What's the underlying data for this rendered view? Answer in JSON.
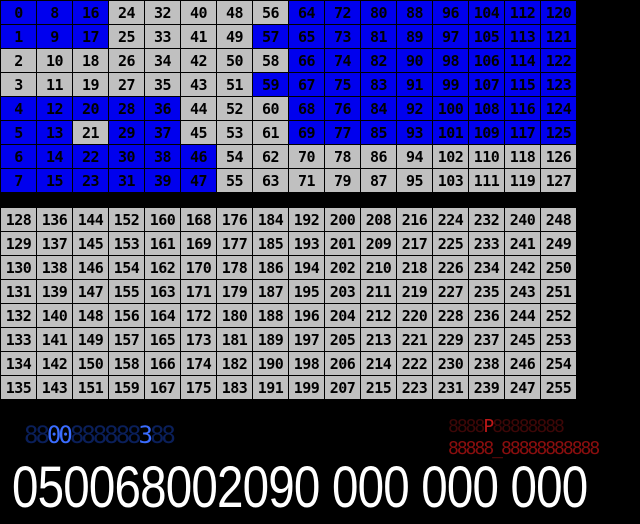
{
  "colors": {
    "active": "#0000ee",
    "inactive": "#c0c0c0",
    "background": "#000000",
    "lcd_blue": "#3a6cff",
    "lcd_red": "#c01818"
  },
  "top_grid": {
    "start": 0,
    "active": [
      0,
      1,
      4,
      5,
      6,
      7,
      8,
      9,
      12,
      13,
      14,
      15,
      16,
      17,
      20,
      22,
      23,
      28,
      29,
      30,
      31,
      36,
      37,
      38,
      39,
      46,
      47,
      57,
      59,
      64,
      65,
      66,
      67,
      68,
      69,
      72,
      73,
      74,
      75,
      76,
      77,
      80,
      81,
      82,
      83,
      84,
      85,
      88,
      89,
      90,
      91,
      92,
      93,
      96,
      97,
      98,
      99,
      100,
      101,
      104,
      105,
      106,
      107,
      108,
      109,
      112,
      113,
      114,
      115,
      116,
      117,
      120,
      121,
      122,
      123,
      124,
      125
    ]
  },
  "bottom_grid": {
    "start": 128,
    "active": []
  },
  "lcd_blue": {
    "dim_prefix": "88",
    "lit_a": "00",
    "dim_mid": "888888",
    "lit_b": "3",
    "dim_suffix": "88"
  },
  "lcd_red_line1": {
    "dim_a": "8888",
    "lit": "P",
    "dim_b": "88888888"
  },
  "lcd_red_line2": "88888_88888888888",
  "readout": "050068002090 000 000 000"
}
